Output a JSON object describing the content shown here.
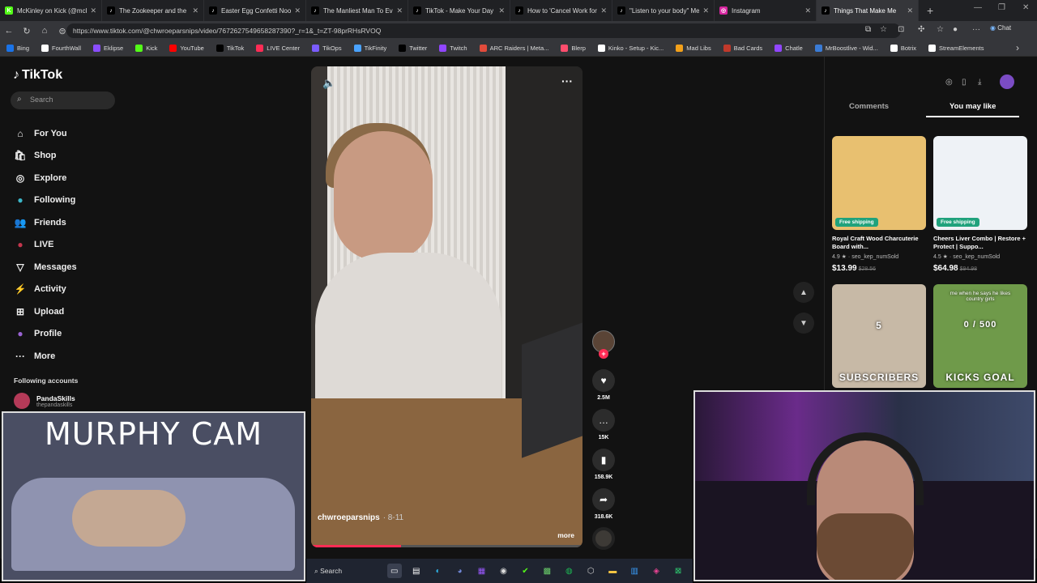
{
  "browser": {
    "tabs": [
      {
        "title": "McKinley on Kick (@mckin",
        "color": "#53fc18",
        "glyph": "K"
      },
      {
        "title": "The Zookeeper and the Pa",
        "color": "#000000",
        "glyph": "♪"
      },
      {
        "title": "Easter Egg Confetti Noodl",
        "color": "#000000",
        "glyph": "♪"
      },
      {
        "title": "The Manliest Man To Ever",
        "color": "#000000",
        "glyph": "♪"
      },
      {
        "title": "TikTok - Make Your Day",
        "color": "#000000",
        "glyph": "♪"
      },
      {
        "title": "How to 'Cancel Work for th",
        "color": "#000000",
        "glyph": "♪"
      },
      {
        "title": "\"Listen to your body\" Mem",
        "color": "#000000",
        "glyph": "♪"
      },
      {
        "title": "Instagram",
        "color": "#d6249f",
        "glyph": "◎"
      },
      {
        "title": "Things That Make Me",
        "color": "#000000",
        "glyph": "♪"
      }
    ],
    "url": "https://www.tiktok.com/@chwroeparsnips/video/7672627549658287390?_r=1&_t=ZT-98prRHsRVOQ",
    "chat_label": "Chat",
    "bookmarks": [
      {
        "label": "Bing",
        "color": "#1a73e8"
      },
      {
        "label": "FourthWall",
        "color": "#ffffff"
      },
      {
        "label": "Eklipse",
        "color": "#8a4dff"
      },
      {
        "label": "Kick",
        "color": "#53fc18"
      },
      {
        "label": "YouTube",
        "color": "#ff0000"
      },
      {
        "label": "TikTok",
        "color": "#000000"
      },
      {
        "label": "LIVE Center",
        "color": "#fe2c55"
      },
      {
        "label": "TikOps",
        "color": "#7a5cff"
      },
      {
        "label": "TikFinity",
        "color": "#4aa3ff"
      },
      {
        "label": "Twitter",
        "color": "#000000"
      },
      {
        "label": "Twitch",
        "color": "#9146ff"
      },
      {
        "label": "ARC Raiders | Meta...",
        "color": "#e14b3b"
      },
      {
        "label": "Blerp",
        "color": "#ff4d6d"
      },
      {
        "label": "Kinko - Setup - Kic...",
        "color": "#ffffff"
      },
      {
        "label": "Mad Libs",
        "color": "#f2a01a"
      },
      {
        "label": "Bad Cards",
        "color": "#c0392b"
      },
      {
        "label": "Chatle",
        "color": "#9146ff"
      },
      {
        "label": "MrBoostlive - Wid...",
        "color": "#3a7bd5"
      },
      {
        "label": "Botrix",
        "color": "#ffffff"
      },
      {
        "label": "StreamElements",
        "color": "#ffffff"
      }
    ]
  },
  "tiktok": {
    "logo": "TikTok",
    "search_placeholder": "Search",
    "nav": [
      {
        "label": "For You",
        "icon": "home-icon",
        "glyph": "⌂"
      },
      {
        "label": "Shop",
        "icon": "shop-bag-icon",
        "glyph": "🛍"
      },
      {
        "label": "Explore",
        "icon": "compass-icon",
        "glyph": "◎"
      },
      {
        "label": "Following",
        "icon": "following-avatar-icon",
        "glyph": "●"
      },
      {
        "label": "Friends",
        "icon": "friends-icon",
        "glyph": "👥"
      },
      {
        "label": "LIVE",
        "icon": "live-avatar-icon",
        "glyph": "●"
      },
      {
        "label": "Messages",
        "icon": "messages-icon",
        "glyph": "▽"
      },
      {
        "label": "Activity",
        "icon": "activity-icon",
        "glyph": "⚡"
      },
      {
        "label": "Upload",
        "icon": "upload-icon",
        "glyph": "⊞"
      },
      {
        "label": "Profile",
        "icon": "profile-avatar-icon",
        "glyph": "●"
      },
      {
        "label": "More",
        "icon": "more-dots-icon",
        "glyph": "···"
      }
    ],
    "following_header": "Following accounts",
    "following_accounts": [
      {
        "name": "PandaSkills",
        "handle": "thepandaskills"
      }
    ],
    "video": {
      "author": "chwroeparsnips",
      "date": "· 8-11",
      "more_label": "more",
      "progress": 0.33
    },
    "actions": {
      "likes": "2.5M",
      "comments": "15K",
      "saves": "158.9K",
      "shares": "318.6K"
    },
    "panel": {
      "tab_comments": "Comments",
      "tab_you_may_like": "You may like",
      "products": [
        {
          "badge": "Free shipping",
          "title": "Royal Craft Wood Charcuterie Board with...",
          "rating": "4.9 ★",
          "sold": "seo_kep_numSold",
          "price": "$13.99",
          "old_price": "$28.56",
          "bg": "#e8c070"
        },
        {
          "badge": "Free shipping",
          "title": "Cheers Liver Combo | Restore + Protect | Suppo...",
          "rating": "4.5 ★",
          "sold": "seo_kep_numSold",
          "price": "$64.98",
          "old_price": "$94.98",
          "bg": "#eef2f6"
        }
      ],
      "videos": [
        {
          "caption": "SUBSCRIBERS",
          "counter": "5",
          "bg": "#c7b9a6"
        },
        {
          "caption": "KICKS GOAL",
          "counter": "0 / 500",
          "top_text": "me when he says he likes country girls",
          "bg": "#6f9a4a"
        }
      ]
    }
  },
  "overlays": {
    "murphy_cam_title": "MURPHY CAM"
  },
  "taskbar": {
    "search_label": "Search"
  }
}
